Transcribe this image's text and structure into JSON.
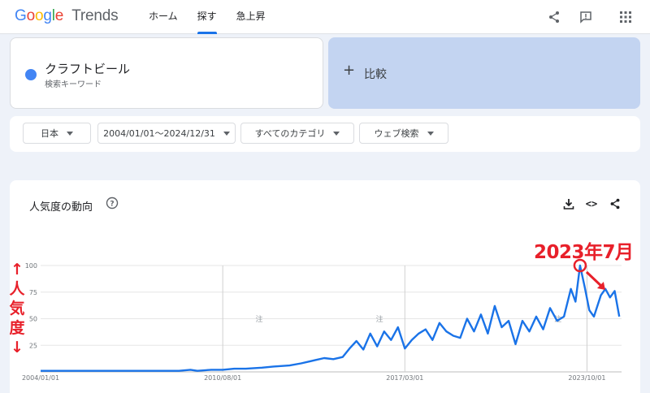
{
  "header": {
    "logo": {
      "google": "Google",
      "product": "Trends"
    },
    "nav": [
      "ホーム",
      "探す",
      "急上昇"
    ],
    "active_nav": "探す",
    "icons": [
      "share-icon",
      "feedback-icon",
      "apps-grid-icon"
    ]
  },
  "term": {
    "name": "クラフトビール",
    "type": "検索キーワード",
    "color": "#4285f4"
  },
  "compare": {
    "label": "比較",
    "icon": "plus-icon"
  },
  "filters": {
    "region": "日本",
    "date_range": "2004/01/01～2024/12/31",
    "category": "すべてのカテゴリ",
    "search_type": "ウェブ検索"
  },
  "chart_card": {
    "title": "人気度の動向",
    "icons": [
      "help-icon",
      "download-icon",
      "embed-code-icon",
      "share-icon"
    ]
  },
  "annotations": {
    "side_label": [
      "↑",
      "人",
      "気",
      "度",
      "↓"
    ],
    "peak_label": "2023年7月",
    "color": "#e8202a"
  },
  "chart_data": {
    "type": "line",
    "series": [
      {
        "name": "クラフトビール",
        "color": "#4285f4"
      }
    ],
    "ylim": [
      0,
      100
    ],
    "yticks": [
      "100",
      "75",
      "50",
      "25"
    ],
    "xtick_labels": [
      "2004/01/01",
      "2010/08/01",
      "2017/03/01",
      "2023/10/01"
    ],
    "note_markers": [
      "注",
      "注",
      "注"
    ],
    "points": [
      [
        "2004-01",
        1
      ],
      [
        "2005-01",
        1
      ],
      [
        "2006-01",
        1
      ],
      [
        "2007-01",
        1
      ],
      [
        "2008-01",
        1
      ],
      [
        "2009-01",
        1
      ],
      [
        "2009-06",
        2
      ],
      [
        "2009-09",
        1
      ],
      [
        "2010-03",
        2
      ],
      [
        "2010-08",
        2
      ],
      [
        "2011-01",
        3
      ],
      [
        "2011-06",
        3
      ],
      [
        "2012-01",
        4
      ],
      [
        "2012-06",
        5
      ],
      [
        "2013-01",
        6
      ],
      [
        "2013-06",
        8
      ],
      [
        "2013-12",
        11
      ],
      [
        "2014-04",
        13
      ],
      [
        "2014-08",
        12
      ],
      [
        "2014-12",
        14
      ],
      [
        "2015-03",
        22
      ],
      [
        "2015-06",
        29
      ],
      [
        "2015-09",
        21
      ],
      [
        "2015-12",
        36
      ],
      [
        "2016-03",
        24
      ],
      [
        "2016-06",
        38
      ],
      [
        "2016-09",
        30
      ],
      [
        "2016-12",
        42
      ],
      [
        "2017-03",
        22
      ],
      [
        "2017-06",
        30
      ],
      [
        "2017-09",
        36
      ],
      [
        "2017-12",
        40
      ],
      [
        "2018-03",
        30
      ],
      [
        "2018-06",
        46
      ],
      [
        "2018-09",
        38
      ],
      [
        "2018-12",
        34
      ],
      [
        "2019-03",
        32
      ],
      [
        "2019-06",
        50
      ],
      [
        "2019-09",
        38
      ],
      [
        "2019-12",
        54
      ],
      [
        "2020-03",
        36
      ],
      [
        "2020-06",
        62
      ],
      [
        "2020-09",
        42
      ],
      [
        "2020-12",
        48
      ],
      [
        "2021-03",
        26
      ],
      [
        "2021-06",
        48
      ],
      [
        "2021-09",
        38
      ],
      [
        "2021-12",
        52
      ],
      [
        "2022-03",
        40
      ],
      [
        "2022-06",
        60
      ],
      [
        "2022-09",
        48
      ],
      [
        "2022-12",
        52
      ],
      [
        "2023-03",
        78
      ],
      [
        "2023-05",
        66
      ],
      [
        "2023-07",
        100
      ],
      [
        "2023-09",
        80
      ],
      [
        "2023-11",
        58
      ],
      [
        "2024-01",
        52
      ],
      [
        "2024-04",
        72
      ],
      [
        "2024-06",
        78
      ],
      [
        "2024-08",
        70
      ],
      [
        "2024-10",
        76
      ],
      [
        "2024-12",
        52
      ]
    ]
  }
}
